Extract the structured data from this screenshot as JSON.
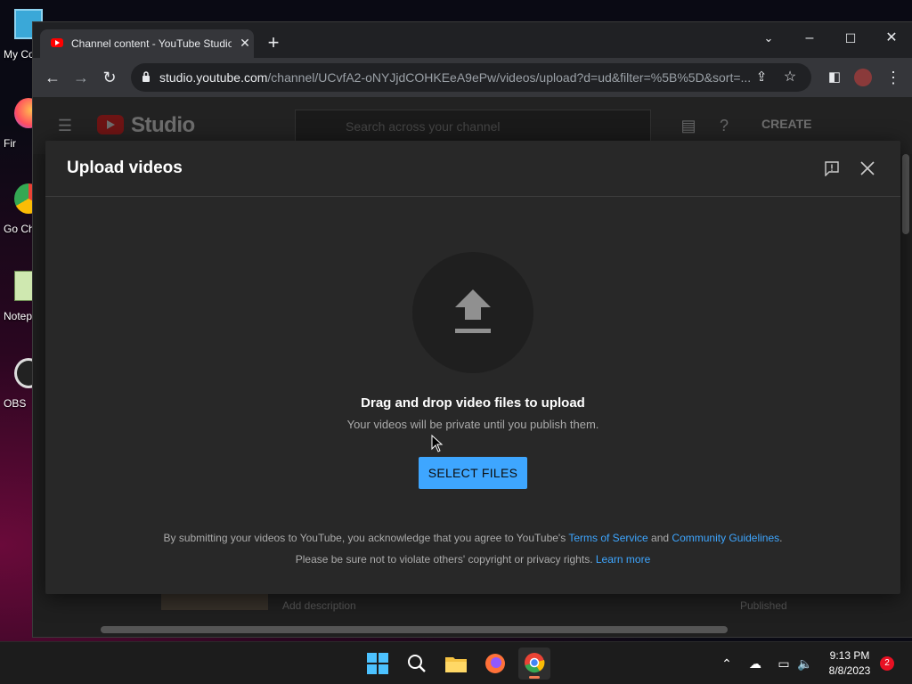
{
  "desktop": {
    "icons": [
      {
        "label": "My Co"
      },
      {
        "label": "Fir"
      },
      {
        "label": "Go Chr"
      },
      {
        "label": "Notep"
      },
      {
        "label": "OBS"
      }
    ]
  },
  "browser": {
    "tab_title": "Channel content - YouTube Studio",
    "url_host": "studio.youtube.com",
    "url_path": "/channel/UCvfA2-oNYJjdCOHKEeA9ePw/videos/upload?d=ud&filter=%5B%5D&sort=..."
  },
  "studio": {
    "logo_text": "Studio",
    "search_placeholder": "Search across your channel",
    "create_label": "CREATE",
    "bg_row_desc": "Add description",
    "bg_row_status": "Published"
  },
  "dialog": {
    "title": "Upload videos",
    "drag_text": "Drag and drop video files to upload",
    "private_text": "Your videos will be private until you publish them.",
    "select_button": "SELECT FILES",
    "legal_prefix": "By submitting your videos to YouTube, you acknowledge that you agree to YouTube's",
    "terms_link": "Terms of Service",
    "and_text": "and",
    "guidelines_link": "Community Guidelines",
    "period": ".",
    "legal2_text": "Please be sure not to violate others' copyright or privacy rights.",
    "learn_more": "Learn more"
  },
  "taskbar": {
    "time": "9:13 PM",
    "date": "8/8/2023",
    "notification_count": "2"
  },
  "colors": {
    "accent": "#3ea6ff",
    "dialog_bg": "#282828",
    "youtube_red": "#ff0000"
  }
}
